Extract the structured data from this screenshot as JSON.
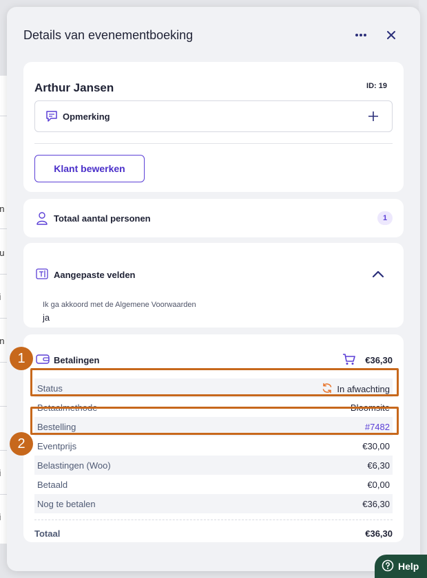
{
  "background": {
    "fragments": [
      "en",
      "eu",
      "si",
      "en",
      "r",
      "r",
      "si",
      "si"
    ]
  },
  "panel": {
    "title": "Details van evenementboeking",
    "more_icon": "more-horizontal-icon",
    "close_icon": "close-icon"
  },
  "customer": {
    "name": "Arthur Jansen",
    "id_label": "ID: 19",
    "note_label": "Opmerking",
    "note_icon": "comment-icon",
    "add_icon": "plus-icon",
    "edit_button": "Klant bewerken"
  },
  "persons": {
    "label": "Totaal aantal personen",
    "count": "1",
    "icon": "person-icon"
  },
  "custom_fields": {
    "label": "Aangepaste velden",
    "icon": "text-field-icon",
    "toggle_icon": "chevron-up-icon",
    "question": "Ik ga akkoord met de Algemene Voorwaarden",
    "answer": "ja"
  },
  "payments": {
    "label": "Betalingen",
    "icon": "wallet-icon",
    "cart_icon": "cart-icon",
    "total_top": "€36,30",
    "rows": [
      {
        "key": "Status",
        "value": "In afwachting"
      },
      {
        "key": "Betaalmethode",
        "value": "Bloomsite"
      },
      {
        "key": "Bestelling",
        "value": "#7482"
      },
      {
        "key": "Eventprijs",
        "value": "€30,00"
      },
      {
        "key": "Belastingen (Woo)",
        "value": "€6,30"
      },
      {
        "key": "Betaald",
        "value": "€0,00"
      },
      {
        "key": "Nog te betalen",
        "value": "€36,30"
      }
    ],
    "status_icon": "sync-icon",
    "total_label": "Totaal",
    "total_value": "€36,30"
  },
  "annotations": {
    "callout_1": "1",
    "callout_2": "2"
  },
  "help": {
    "label": "Help",
    "icon": "help-circle-icon"
  },
  "colors": {
    "accent": "#5b3fd6",
    "annotation": "#c7681c",
    "status_pending": "#e8742a",
    "help_bg": "#1f4d3a"
  }
}
